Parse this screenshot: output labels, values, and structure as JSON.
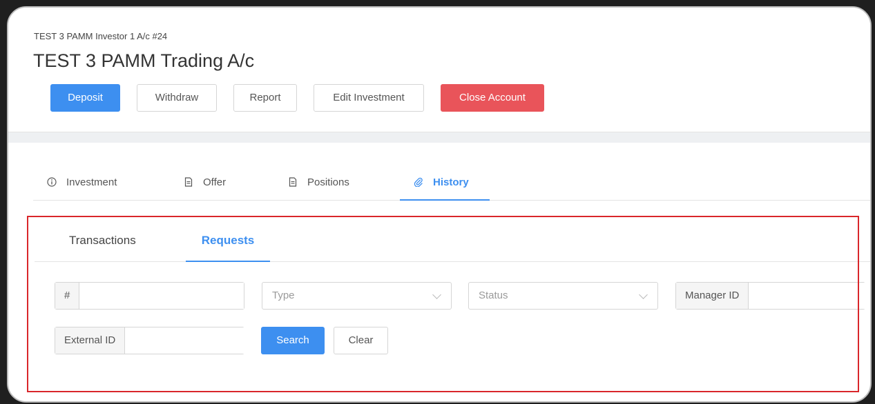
{
  "header": {
    "subtitle": "TEST 3 PAMM Investor 1 A/c #24",
    "title": "TEST 3 PAMM Trading A/c"
  },
  "actions": {
    "deposit": "Deposit",
    "withdraw": "Withdraw",
    "report": "Report",
    "edit_investment": "Edit Investment",
    "close_account": "Close Account"
  },
  "tabs": [
    {
      "label": "Investment",
      "icon": "info-icon"
    },
    {
      "label": "Offer",
      "icon": "document-icon"
    },
    {
      "label": "Positions",
      "icon": "document-icon"
    },
    {
      "label": "History",
      "icon": "paperclip-icon",
      "active": true
    }
  ],
  "subtabs": [
    {
      "label": "Transactions"
    },
    {
      "label": "Requests",
      "active": true
    }
  ],
  "filters": {
    "id_addon": "#",
    "id_value": "",
    "type_placeholder": "Type",
    "status_placeholder": "Status",
    "manager_addon": "Manager ID",
    "manager_value": "",
    "external_addon": "External ID",
    "external_value": "",
    "search_label": "Search",
    "clear_label": "Clear"
  },
  "colors": {
    "primary": "#3d8ff0",
    "danger": "#e9545a",
    "highlight": "#d9262a"
  }
}
